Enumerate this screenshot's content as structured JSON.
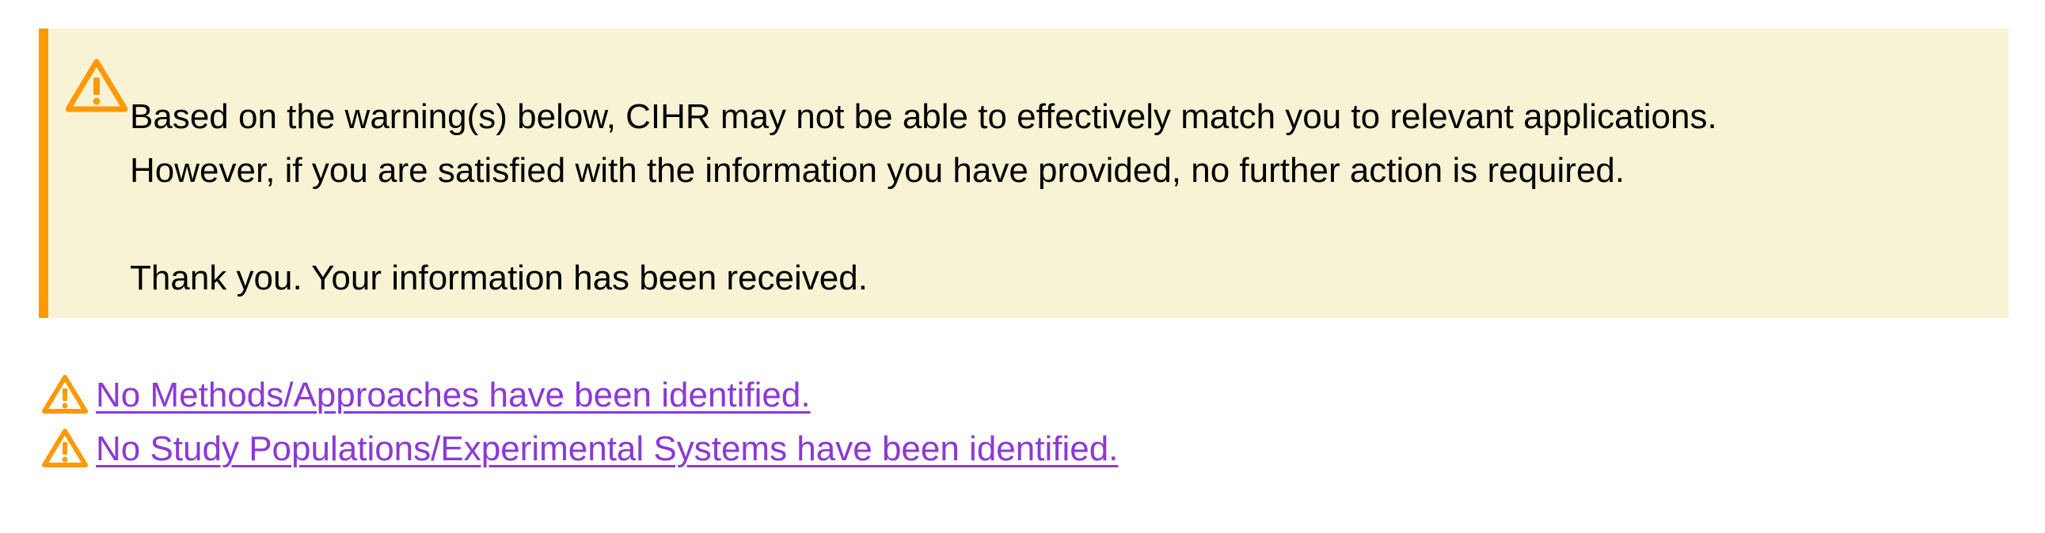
{
  "alert": {
    "icon": "warning-triangle-icon",
    "line1": "Based on the warning(s) below, CIHR may not be able to effectively match you to relevant applications.",
    "line2": "However, if you are satisfied with the information you have provided, no further action is required.",
    "line3": "Thank you. Your information has been received.",
    "colors": {
      "background": "#f8f3d4",
      "accent_bar": "#ff9900",
      "icon": "#ff9900"
    }
  },
  "warnings": [
    {
      "icon": "warning-triangle-icon",
      "link_text": "No Methods/Approaches have been identified."
    },
    {
      "icon": "warning-triangle-icon",
      "link_text": "No Study Populations/Experimental Systems have been identified."
    }
  ],
  "link_color": "#8a39d6"
}
